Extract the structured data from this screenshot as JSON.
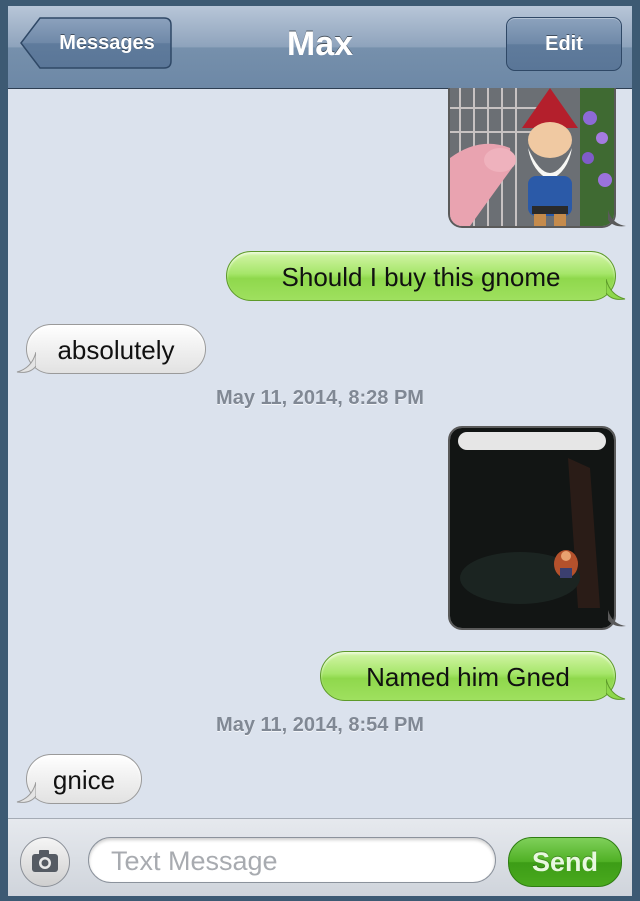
{
  "navbar": {
    "back_label": "Messages",
    "title": "Max",
    "edit_label": "Edit"
  },
  "messages": [
    {
      "type": "photo",
      "direction": "out",
      "description_icon": "gnome-photo"
    },
    {
      "type": "text",
      "direction": "out",
      "text": "Should I buy this gnome"
    },
    {
      "type": "text",
      "direction": "in",
      "text": "absolutely"
    },
    {
      "type": "timestamp",
      "text": "May 11, 2014, 8:28 PM"
    },
    {
      "type": "photo",
      "direction": "out",
      "description_icon": "dark-gnome-photo"
    },
    {
      "type": "text",
      "direction": "out",
      "text": "Named him Gned"
    },
    {
      "type": "timestamp",
      "text": "May 11, 2014, 8:54 PM"
    },
    {
      "type": "text",
      "direction": "in",
      "text": "gnice"
    }
  ],
  "input_bar": {
    "camera_icon": "camera-icon",
    "placeholder": "Text Message",
    "send_label": "Send"
  },
  "colors": {
    "outgoing_bubble": "#9fe05f",
    "incoming_bubble": "#f0f0f0",
    "navbar": "#7690ac",
    "background": "#dbe2ed",
    "send_button": "#4fb024"
  }
}
